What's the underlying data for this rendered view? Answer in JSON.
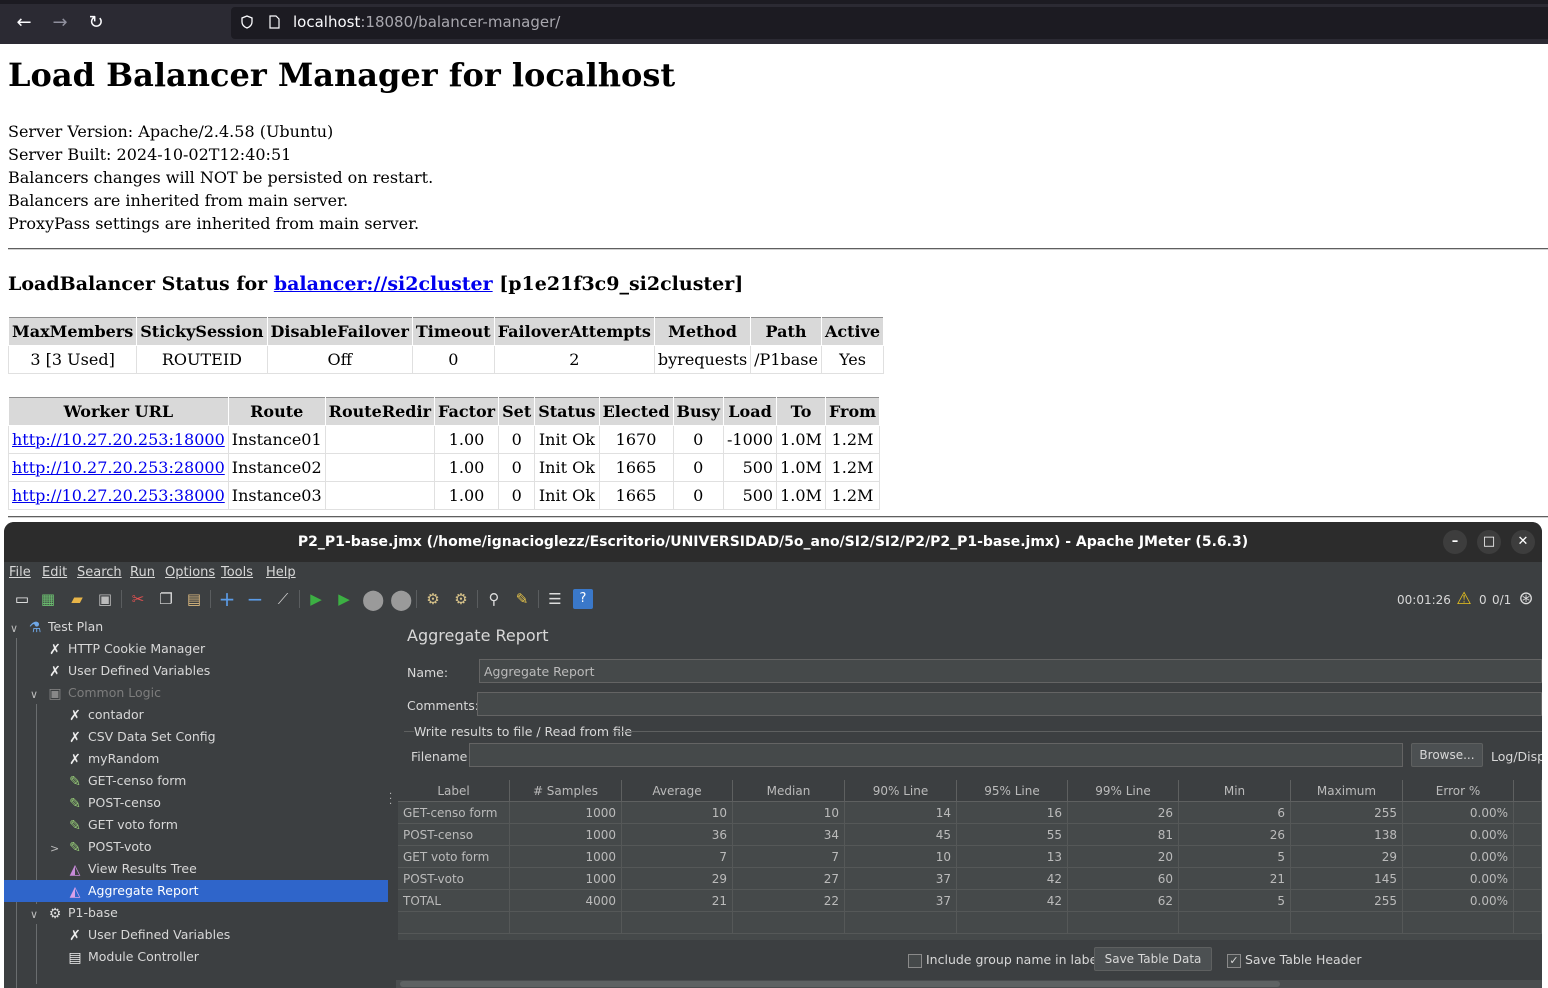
{
  "browser": {
    "url_host": "localhost",
    "url_rest": ":18080/balancer-manager/"
  },
  "page": {
    "title": "Load Balancer Manager for localhost",
    "info_lines": [
      "Server Version: Apache/2.4.58 (Ubuntu)",
      "Server Built: 2024-10-02T12:40:51",
      "Balancers changes will NOT be persisted on restart.",
      "Balancers are inherited from main server.",
      "ProxyPass settings are inherited from main server."
    ],
    "status_heading_prefix": "LoadBalancer Status for",
    "balancer_link": "balancer://si2cluster",
    "balancer_id": "[p1e21f3c9_si2cluster]",
    "balancer_table": {
      "headers": [
        "MaxMembers",
        "StickySession",
        "DisableFailover",
        "Timeout",
        "FailoverAttempts",
        "Method",
        "Path",
        "Active"
      ],
      "row": [
        "3 [3 Used]",
        "ROUTEID",
        "Off",
        "0",
        "2",
        "byrequests",
        "/P1base",
        "Yes"
      ]
    },
    "worker_table": {
      "headers": [
        "Worker URL",
        "Route",
        "RouteRedir",
        "Factor",
        "Set",
        "Status",
        "Elected",
        "Busy",
        "Load",
        "To",
        "From"
      ],
      "rows": [
        [
          "http://10.27.20.253:18000",
          "Instance01",
          "",
          "1.00",
          "0",
          "Init Ok",
          "1670",
          "0",
          "-1000",
          "1.0M",
          "1.2M"
        ],
        [
          "http://10.27.20.253:28000",
          "Instance02",
          "",
          "1.00",
          "0",
          "Init Ok",
          "1665",
          "0",
          "500",
          "1.0M",
          "1.2M"
        ],
        [
          "http://10.27.20.253:38000",
          "Instance03",
          "",
          "1.00",
          "0",
          "Init Ok",
          "1665",
          "0",
          "500",
          "1.0M",
          "1.2M"
        ]
      ]
    }
  },
  "jmeter": {
    "window_title": "P2_P1-base.jmx (/home/ignacioglezz/Escritorio/UNIVERSIDAD/5o_ano/SI2/SI2/P2/P2_P1-base.jmx) - Apache JMeter (5.6.3)",
    "menu": [
      "File",
      "Edit",
      "Search",
      "Run",
      "Options",
      "Tools",
      "Help"
    ],
    "elapsed": "00:01:26",
    "warnings": "0",
    "threads": "0/1",
    "tree": [
      {
        "label": "Test Plan",
        "icon": "test-plan-icon"
      },
      {
        "label": "HTTP Cookie Manager",
        "icon": "config-icon"
      },
      {
        "label": "User Defined Variables",
        "icon": "config-icon"
      },
      {
        "label": "Common Logic",
        "icon": "controller-icon"
      },
      {
        "label": "contador",
        "icon": "config-icon"
      },
      {
        "label": "CSV Data Set Config",
        "icon": "config-icon"
      },
      {
        "label": "myRandom",
        "icon": "config-icon"
      },
      {
        "label": "GET-censo form",
        "icon": "sampler-icon"
      },
      {
        "label": "POST-censo",
        "icon": "sampler-icon"
      },
      {
        "label": "GET voto form",
        "icon": "sampler-icon"
      },
      {
        "label": "POST-voto",
        "icon": "sampler-icon"
      },
      {
        "label": "View Results Tree",
        "icon": "listener-icon"
      },
      {
        "label": "Aggregate Report",
        "icon": "listener-icon"
      },
      {
        "label": "P1-base",
        "icon": "thread-group-icon"
      },
      {
        "label": "User Defined Variables",
        "icon": "config-icon"
      },
      {
        "label": "Module Controller",
        "icon": "module-controller-icon"
      }
    ],
    "report": {
      "title": "Aggregate Report",
      "name_label": "Name:",
      "name_value": "Aggregate Report",
      "comments_label": "Comments:",
      "file_group": "Write results to file / Read from file",
      "filename_label": "Filename",
      "browse": "Browse...",
      "log_display": "Log/Disp",
      "columns": [
        "Label",
        "# Samples",
        "Average",
        "Median",
        "90% Line",
        "95% Line",
        "99% Line",
        "Min",
        "Maximum",
        "Error %"
      ],
      "rows": [
        [
          "GET-censo form",
          "1000",
          "10",
          "10",
          "14",
          "16",
          "26",
          "6",
          "255",
          "0.00%"
        ],
        [
          "POST-censo",
          "1000",
          "36",
          "34",
          "45",
          "55",
          "81",
          "26",
          "138",
          "0.00%"
        ],
        [
          "GET voto form",
          "1000",
          "7",
          "7",
          "10",
          "13",
          "20",
          "5",
          "29",
          "0.00%"
        ],
        [
          "POST-voto",
          "1000",
          "29",
          "27",
          "37",
          "42",
          "60",
          "21",
          "145",
          "0.00%"
        ],
        [
          "TOTAL",
          "4000",
          "21",
          "22",
          "37",
          "42",
          "62",
          "5",
          "255",
          "0.00%"
        ]
      ],
      "include_group_label": "Include group name in label?",
      "save_table_data": "Save Table Data",
      "save_table_header": "Save Table Header"
    }
  }
}
